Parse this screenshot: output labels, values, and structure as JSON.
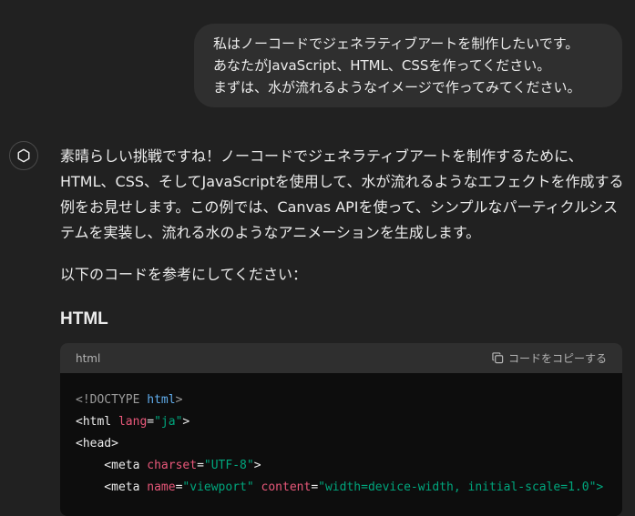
{
  "user_message": {
    "lines": [
      "私はノーコードでジェネラティブアートを制作したいです。",
      "あなたがJavaScript、HTML、CSSを作ってください。",
      "まずは、水が流れるようなイメージで作ってみてください。"
    ]
  },
  "assistant": {
    "icon": "openai-logo-icon",
    "intro_lines": [
      "素晴らしい挑戦ですね！ノーコードでジェネラティブアートを制作するために、",
      "HTML、CSS、そしてJavaScriptを使用して、水が流れるようなエフェクトを作成する",
      "例をお見せします。この例では、Canvas APIを使って、シンプルなパーティクルシス",
      "テムを実装し、流れる水のようなアニメーションを生成します。"
    ],
    "followup": "以下のコードを参考にしてください：",
    "section_heading": "HTML"
  },
  "code_block": {
    "language": "html",
    "copy_label": "コードをコピーする",
    "lines": {
      "l1_open": "<!DOCTYPE ",
      "l1_kw": "html",
      "l1_close": ">",
      "l2_open": "<html ",
      "l2_attr": "lang",
      "l2_eq": "=",
      "l2_val": "\"ja\"",
      "l2_close": ">",
      "l3": "<head>",
      "l4_open": "    <meta ",
      "l4_attr": "charset",
      "l4_eq": "=",
      "l4_val": "\"UTF-8\"",
      "l4_close": ">",
      "l5_open": "    <meta ",
      "l5_attr1": "name",
      "l5_eq1": "=",
      "l5_val1": "\"viewport\"",
      "l5_sp": " ",
      "l5_attr2": "content",
      "l5_eq2": "=",
      "l5_val2": "\"width=device-width, initial-scale=1.0\">"
    }
  },
  "colors": {
    "background": "#212121",
    "bubble": "#2f2f2f",
    "code_bg": "#0d0d0d",
    "code_header": "#2f2f2f",
    "keyword": "#61aeee",
    "attribute": "#e9587a",
    "string": "#00a67d"
  }
}
